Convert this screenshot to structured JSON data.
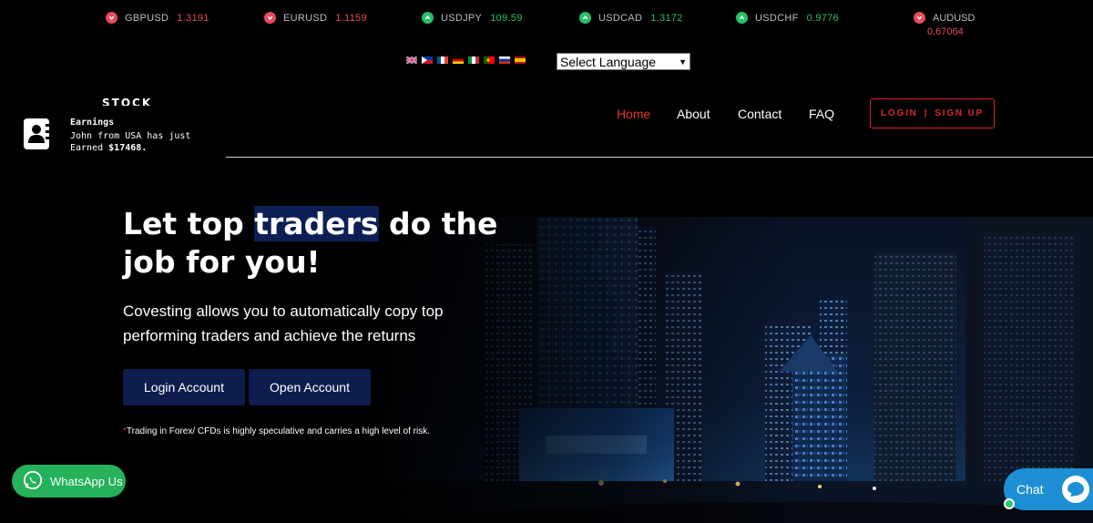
{
  "ticker": [
    {
      "symbol": "GBPUSD",
      "value": "1.3191",
      "direction": "down"
    },
    {
      "symbol": "EURUSD",
      "value": "1.1159",
      "direction": "down"
    },
    {
      "symbol": "USDJPY",
      "value": "109.59",
      "direction": "up"
    },
    {
      "symbol": "USDCAD",
      "value": "1.3172",
      "direction": "up"
    },
    {
      "symbol": "USDCHF",
      "value": "0.9776",
      "direction": "up"
    },
    {
      "symbol": "AUDUSD",
      "value": "0.67064",
      "direction": "down"
    }
  ],
  "language": {
    "flags": [
      "uk-flag-icon",
      "philippines-flag-icon",
      "france-flag-icon",
      "germany-flag-icon",
      "italy-flag-icon",
      "portugal-flag-icon",
      "russia-flag-icon",
      "spain-flag-icon"
    ],
    "select_label": "Select Language"
  },
  "logo": {
    "text": "STOCK"
  },
  "nav": {
    "items": [
      "Home",
      "About",
      "Contact",
      "FAQ"
    ],
    "active": "Home",
    "login": "LOGIN",
    "separator": "|",
    "signup": "SIGN UP"
  },
  "notification": {
    "title": "Earnings",
    "line1": "John from USA has just",
    "line2_prefix": "Earned",
    "amount": "$17468."
  },
  "hero": {
    "headline_part1": "Let top",
    "headline_highlight": "traders",
    "headline_part2": "do the job for you!",
    "subtext": "Covesting allows you to automatically copy top performing traders and achieve the returns",
    "btn_login": "Login Account",
    "btn_open": "Open Account",
    "disclaimer_star": "*",
    "disclaimer": "Trading in Forex/ CFDs is highly speculative and carries a high level of risk."
  },
  "whatsapp": {
    "label": "WhatsApp Us"
  },
  "chat": {
    "label": "Chat"
  },
  "colors": {
    "down": "#e8495e",
    "up": "#27c067",
    "accent_red": "#e3342f",
    "button_navy": "#0e1d4d",
    "whatsapp": "#25b25b",
    "chat": "#1e8fd4"
  }
}
